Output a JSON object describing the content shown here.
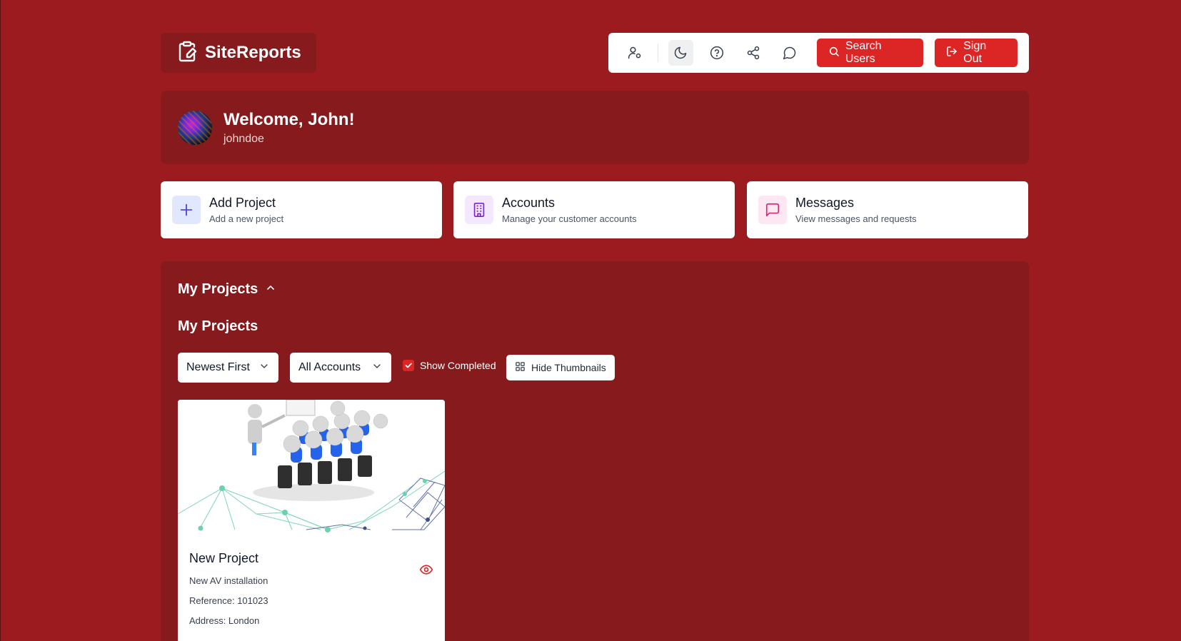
{
  "header": {
    "app_name": "SiteReports",
    "toolbar_icons": [
      "user-settings-icon",
      "moon-icon",
      "help-icon",
      "share-icon",
      "chat-icon"
    ],
    "search_users_label": "Search Users",
    "sign_out_label": "Sign Out"
  },
  "welcome": {
    "title": "Welcome, John!",
    "username": "johndoe"
  },
  "actions": [
    {
      "title": "Add Project",
      "subtitle": "Add a new project",
      "icon": "plus-icon",
      "icon_color": "#4f46e5",
      "icon_bg": "#e0e7ff"
    },
    {
      "title": "Accounts",
      "subtitle": "Manage your customer accounts",
      "icon": "building-icon",
      "icon_color": "#7e22ce",
      "icon_bg": "#f3e8ff"
    },
    {
      "title": "Messages",
      "subtitle": "View messages and requests",
      "icon": "message-icon",
      "icon_color": "#db2777",
      "icon_bg": "#fce7f3"
    }
  ],
  "projects": {
    "toggle_label": "My Projects",
    "title": "My Projects",
    "sort_value": "Newest First",
    "account_filter_value": "All Accounts",
    "show_completed_label": "Show Completed",
    "show_completed_checked": true,
    "hide_thumbnails_label": "Hide Thumbnails",
    "items": [
      {
        "title": "New Project",
        "description": "New AV installation",
        "reference": "Reference: 101023",
        "address": "Address: London"
      }
    ]
  },
  "colors": {
    "background": "#9b1b1e",
    "panel": "#861a1c",
    "accent": "#dc2626"
  }
}
